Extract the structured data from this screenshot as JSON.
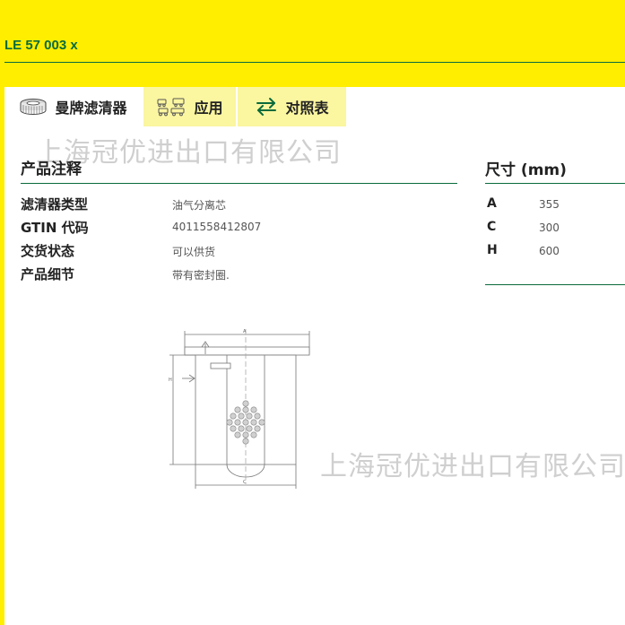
{
  "header": {
    "product_code": "LE 57 003 x"
  },
  "tabs": [
    {
      "label": "曼牌滤清器",
      "icon": "filter-icon",
      "active": true
    },
    {
      "label": "应用",
      "icon": "vehicles-icon",
      "active": false
    },
    {
      "label": "对照表",
      "icon": "swap-arrows-icon",
      "active": false
    }
  ],
  "watermark": "上海冠优进出口有限公司",
  "attributes": {
    "title": "产品注释",
    "rows": [
      {
        "label": "滤清器类型",
        "value": "油气分离芯"
      },
      {
        "label": "GTIN 代码",
        "value": "4011558412807"
      },
      {
        "label": "交货状态",
        "value": "可以供货"
      },
      {
        "label": "产品细节",
        "value": "带有密封圈."
      }
    ]
  },
  "dimensions": {
    "title": "尺寸 (mm)",
    "rows": [
      {
        "label": "A",
        "value": "355"
      },
      {
        "label": "C",
        "value": "300"
      },
      {
        "label": "H",
        "value": "600"
      }
    ]
  },
  "drawing": {
    "labels": {
      "top": "A",
      "side": "H",
      "bottom": "C"
    }
  },
  "colors": {
    "brand_yellow": "#ffee00",
    "brand_green": "#0a6b3c"
  }
}
